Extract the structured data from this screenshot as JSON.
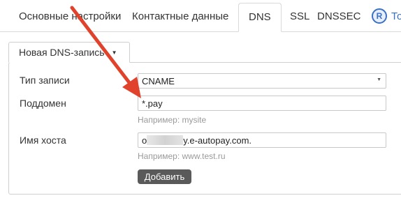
{
  "tabs": {
    "basic": "Основные настройки",
    "contacts": "Контактные данные",
    "dns": "DNS",
    "ssl": "SSL",
    "dnssec": "DNSSEC",
    "extra_badge": "R",
    "extra": "То"
  },
  "panel": {
    "tab_label": "Новая DNS-запись"
  },
  "form": {
    "record_type": {
      "label": "Тип записи",
      "value": "CNAME"
    },
    "subdomain": {
      "label": "Поддомен",
      "value": "*.pay",
      "help": "Например: mysite"
    },
    "host": {
      "label": "Имя хоста",
      "value_prefix": "o",
      "value_suffix": "y.e-autopay.com.",
      "help": "Например: www.test.ru"
    },
    "add_button": "Добавить"
  },
  "colors": {
    "arrow": "#e0422b",
    "button": "#5a5a5a",
    "badge": "#3a70c4"
  }
}
